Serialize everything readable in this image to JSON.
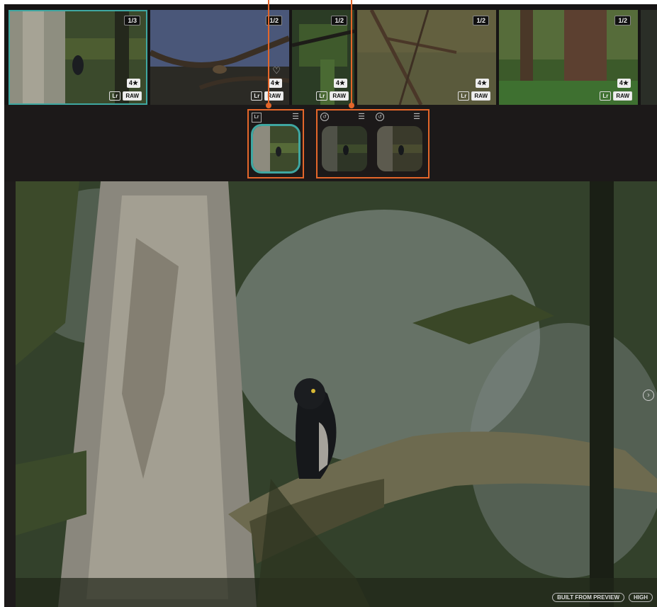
{
  "filmstrip": {
    "thumbnails": [
      {
        "stack": "1/3",
        "rating": "4★",
        "lr": "Lr",
        "raw": "RAW"
      },
      {
        "stack": "1/2",
        "rating": "4★",
        "lr": "Lr",
        "raw": "RAW"
      },
      {
        "stack": "1/2",
        "rating": "4★",
        "lr": "Lr",
        "raw": "RAW"
      },
      {
        "stack": "1/2",
        "rating": "4★",
        "lr": "Lr",
        "raw": "RAW"
      },
      {
        "stack": "1/2",
        "rating": "4★",
        "lr": "Lr",
        "raw": "RAW"
      }
    ]
  },
  "variants": {
    "lr_icon": "Lr",
    "menu_icon": "menu-icon",
    "history_icon": "history-icon"
  },
  "status": {
    "built_from": "BUILT FROM PREVIEW",
    "quality": "HIGH"
  },
  "colors": {
    "accent_teal": "#3fa7a1",
    "callout_orange": "#e4662a"
  }
}
